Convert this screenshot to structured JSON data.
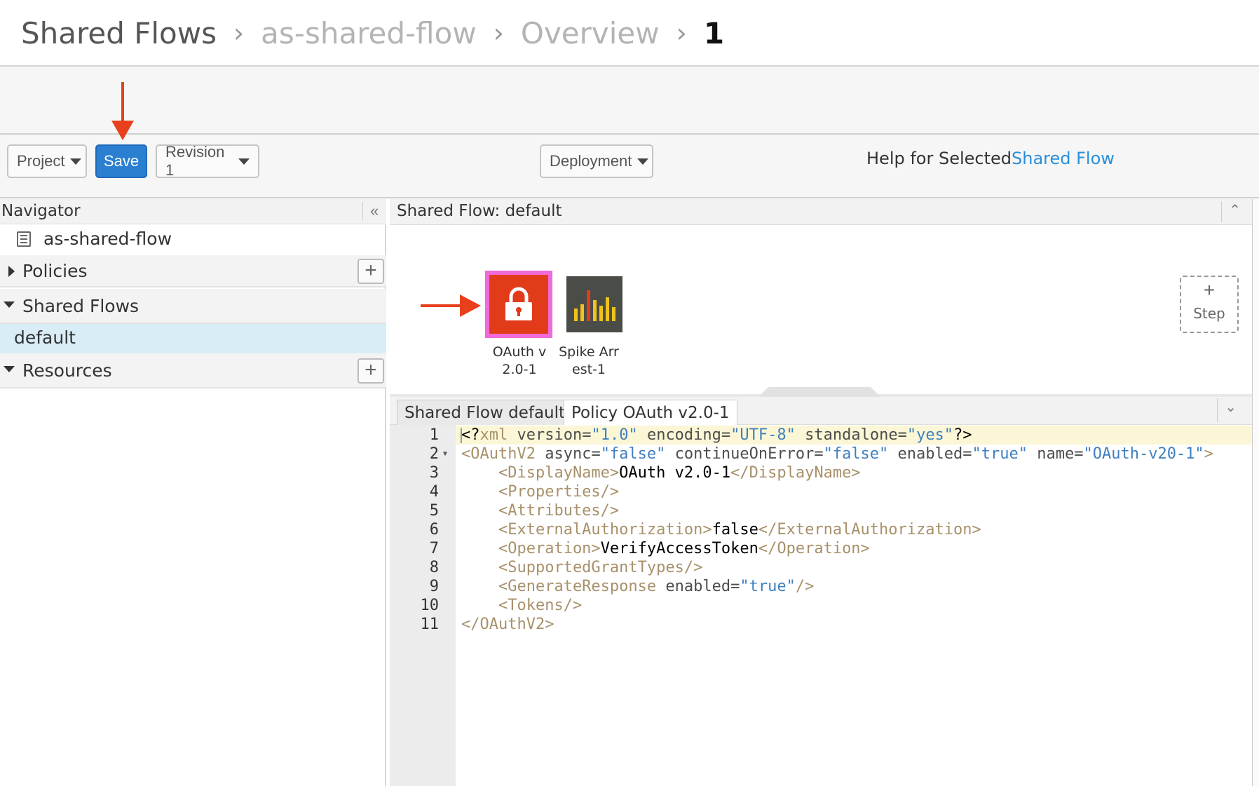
{
  "breadcrumb": {
    "root": "Shared Flows",
    "flow": "as-shared-flow",
    "section": "Overview",
    "revision": "1",
    "separator": "›"
  },
  "toolbar": {
    "project_label": "Project",
    "save_label": "Save",
    "revision_label": "Revision 1",
    "deployment_label": "Deployment",
    "help_label": "Help for Selected",
    "help_link": "Shared Flow"
  },
  "navigator": {
    "title": "Navigator",
    "collapse_icon": "«",
    "root_item": "as-shared-flow",
    "policies_label": "Policies",
    "shared_flows_label": "Shared Flows",
    "selected_flow": "default",
    "resources_label": "Resources"
  },
  "canvas": {
    "title": "Shared Flow: default",
    "policies": [
      {
        "line1": "OAuth v",
        "line2": "2.0-1",
        "icon": "lock-icon",
        "color": "#e23b1a",
        "highlight": "#f06ad8"
      },
      {
        "line1": "Spike Arr",
        "line2": "est-1",
        "icon": "spike-arrest-bars-icon",
        "color": "#4a4d47"
      }
    ],
    "step_plus": "+",
    "step_label": "Step"
  },
  "editor": {
    "tabs": [
      "Shared Flow default",
      "Policy OAuth v2.0-1"
    ],
    "line_numbers": [
      "1",
      "2",
      "3",
      "4",
      "5",
      "6",
      "7",
      "8",
      "9",
      "10",
      "11"
    ]
  },
  "colors": {
    "accent": "#2a7fd1",
    "link": "#2a8fd8",
    "annotation_arrow": "#e8401c",
    "selected_row": "#d9edf7"
  }
}
